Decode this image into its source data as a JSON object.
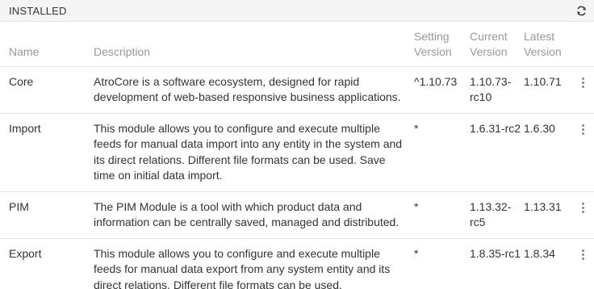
{
  "panel": {
    "title": "INSTALLED",
    "refresh_icon": "refresh-icon"
  },
  "columns": {
    "name": "Name",
    "description": "Description",
    "setting_version": "Setting Version",
    "current_version": "Current Version",
    "latest_version": "Latest Version"
  },
  "rows": [
    {
      "name": "Core",
      "description": "AtroCore is a software ecosystem, designed for rapid development of web-based responsive business applications.",
      "setting_version": "^1.10.73",
      "current_version": "1.10.73-rc10",
      "latest_version": "1.10.71"
    },
    {
      "name": "Import",
      "description": "This module allows you to configure and execute multiple feeds for manual data import into any entity in the system and its direct relations. Different file formats can be used. Save time on initial data import.",
      "setting_version": "*",
      "current_version": "1.6.31-rc2",
      "latest_version": "1.6.30"
    },
    {
      "name": "PIM",
      "description": "The PIM Module is a tool with which product data and information can be centrally saved, managed and distributed.",
      "setting_version": "*",
      "current_version": "1.13.32-rc5",
      "latest_version": "1.13.31"
    },
    {
      "name": "Export",
      "description": "This module allows you to configure and execute multiple feeds for manual data export from any system entity and its direct relations. Different file formats can be used.",
      "setting_version": "*",
      "current_version": "1.8.35-rc1",
      "latest_version": "1.8.34"
    }
  ]
}
